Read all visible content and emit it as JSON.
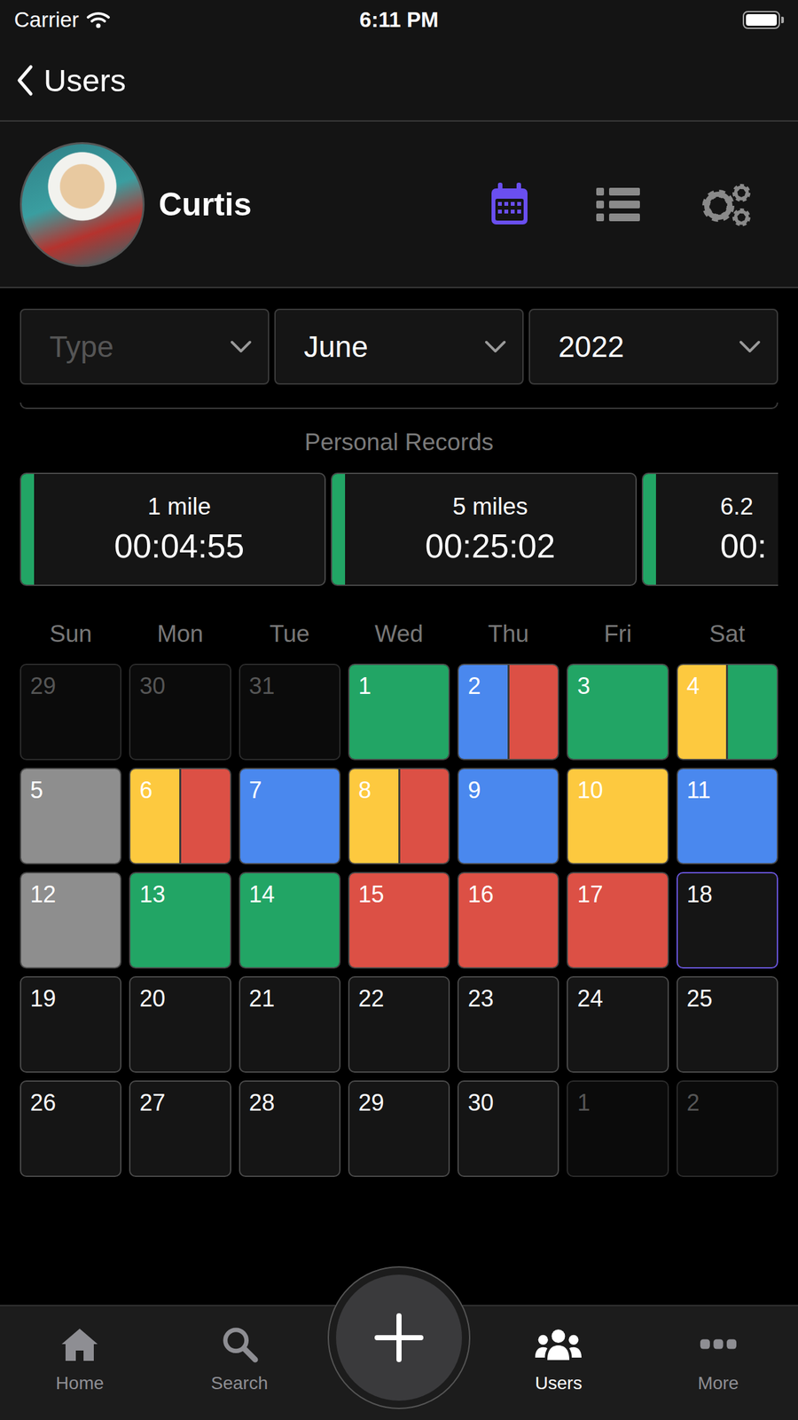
{
  "status_bar": {
    "carrier": "Carrier",
    "time": "6:11 PM",
    "battery_level": 1
  },
  "nav": {
    "back_label": "Users"
  },
  "profile": {
    "name": "Curtis",
    "views": [
      {
        "kind": "calendar",
        "selected": true
      },
      {
        "kind": "list",
        "selected": false
      },
      {
        "kind": "settings",
        "selected": false
      }
    ]
  },
  "filters": [
    {
      "value": "Type",
      "placeholder": true
    },
    {
      "value": "June",
      "placeholder": false
    },
    {
      "value": "2022",
      "placeholder": false
    }
  ],
  "records": {
    "title": "Personal Records",
    "items": [
      {
        "label": "1 mile",
        "time": "00:04:55",
        "kind": "full"
      },
      {
        "label": "5 miles",
        "time": "00:25:02",
        "kind": "full"
      },
      {
        "label": "6.2",
        "time": "00:",
        "kind": "partial"
      }
    ]
  },
  "calendar": {
    "weekdays": [
      "Sun",
      "Mon",
      "Tue",
      "Wed",
      "Thu",
      "Fri",
      "Sat"
    ],
    "days": [
      {
        "day": "29",
        "outside": true,
        "today": false,
        "entries": []
      },
      {
        "day": "30",
        "outside": true,
        "today": false,
        "entries": []
      },
      {
        "day": "31",
        "outside": true,
        "today": false,
        "entries": []
      },
      {
        "day": "1",
        "outside": false,
        "today": false,
        "entries": [
          {
            "color": "#22a565"
          }
        ]
      },
      {
        "day": "2",
        "outside": false,
        "today": false,
        "entries": [
          {
            "color": "#4a88ee"
          },
          {
            "color": "#dc5045"
          }
        ]
      },
      {
        "day": "3",
        "outside": false,
        "today": false,
        "entries": [
          {
            "color": "#22a565"
          }
        ]
      },
      {
        "day": "4",
        "outside": false,
        "today": false,
        "entries": [
          {
            "color": "#fdc93f"
          },
          {
            "color": "#22a565"
          }
        ]
      },
      {
        "day": "5",
        "outside": false,
        "today": false,
        "entries": [
          {
            "color": "#8e8e8e"
          }
        ]
      },
      {
        "day": "6",
        "outside": false,
        "today": false,
        "entries": [
          {
            "color": "#fdc93f"
          },
          {
            "color": "#dc5045"
          }
        ]
      },
      {
        "day": "7",
        "outside": false,
        "today": false,
        "entries": [
          {
            "color": "#4a88ee"
          }
        ]
      },
      {
        "day": "8",
        "outside": false,
        "today": false,
        "entries": [
          {
            "color": "#fdc93f"
          },
          {
            "color": "#dc5045"
          }
        ]
      },
      {
        "day": "9",
        "outside": false,
        "today": false,
        "entries": [
          {
            "color": "#4a88ee"
          }
        ]
      },
      {
        "day": "10",
        "outside": false,
        "today": false,
        "entries": [
          {
            "color": "#fdc93f"
          }
        ]
      },
      {
        "day": "11",
        "outside": false,
        "today": false,
        "entries": [
          {
            "color": "#4a88ee"
          }
        ]
      },
      {
        "day": "12",
        "outside": false,
        "today": false,
        "entries": [
          {
            "color": "#8e8e8e"
          }
        ]
      },
      {
        "day": "13",
        "outside": false,
        "today": false,
        "entries": [
          {
            "color": "#22a565"
          }
        ]
      },
      {
        "day": "14",
        "outside": false,
        "today": false,
        "entries": [
          {
            "color": "#22a565"
          }
        ]
      },
      {
        "day": "15",
        "outside": false,
        "today": false,
        "entries": [
          {
            "color": "#dc5045"
          }
        ]
      },
      {
        "day": "16",
        "outside": false,
        "today": false,
        "entries": [
          {
            "color": "#dc5045"
          }
        ]
      },
      {
        "day": "17",
        "outside": false,
        "today": false,
        "entries": [
          {
            "color": "#dc5045"
          }
        ]
      },
      {
        "day": "18",
        "outside": false,
        "today": true,
        "entries": []
      },
      {
        "day": "19",
        "outside": false,
        "today": false,
        "entries": []
      },
      {
        "day": "20",
        "outside": false,
        "today": false,
        "entries": []
      },
      {
        "day": "21",
        "outside": false,
        "today": false,
        "entries": []
      },
      {
        "day": "22",
        "outside": false,
        "today": false,
        "entries": []
      },
      {
        "day": "23",
        "outside": false,
        "today": false,
        "entries": []
      },
      {
        "day": "24",
        "outside": false,
        "today": false,
        "entries": []
      },
      {
        "day": "25",
        "outside": false,
        "today": false,
        "entries": []
      },
      {
        "day": "26",
        "outside": false,
        "today": false,
        "entries": []
      },
      {
        "day": "27",
        "outside": false,
        "today": false,
        "entries": []
      },
      {
        "day": "28",
        "outside": false,
        "today": false,
        "entries": []
      },
      {
        "day": "29",
        "outside": false,
        "today": false,
        "entries": []
      },
      {
        "day": "30",
        "outside": false,
        "today": false,
        "entries": []
      },
      {
        "day": "1",
        "outside": true,
        "today": false,
        "entries": []
      },
      {
        "day": "2",
        "outside": true,
        "today": false,
        "entries": []
      }
    ]
  },
  "tab_bar": {
    "tabs": [
      {
        "kind": "home",
        "label": "Home",
        "selected": false
      },
      {
        "kind": "search",
        "label": "Search",
        "selected": false
      },
      {
        "kind": "users",
        "label": "Users",
        "selected": true
      },
      {
        "kind": "more",
        "label": "More",
        "selected": false
      }
    ]
  }
}
